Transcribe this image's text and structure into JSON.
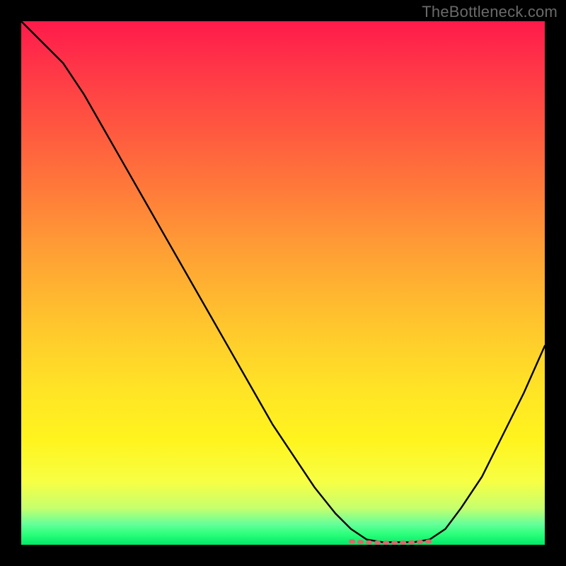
{
  "watermark": "TheBottleneck.com",
  "chart_data": {
    "type": "line",
    "title": "",
    "xlabel": "",
    "ylabel": "",
    "xlim": [
      0,
      100
    ],
    "ylim": [
      0,
      100
    ],
    "grid": false,
    "legend": false,
    "axes_visible": false,
    "background": "red-yellow-green vertical gradient",
    "series": [
      {
        "name": "bottleneck-curve",
        "color": "#000000",
        "x": [
          0,
          4,
          8,
          12,
          16,
          20,
          24,
          28,
          32,
          36,
          40,
          44,
          48,
          52,
          56,
          60,
          63,
          66,
          69,
          72,
          75,
          78,
          81,
          84,
          88,
          92,
          96,
          100
        ],
        "y": [
          100,
          96,
          92,
          86,
          79,
          72,
          65,
          58,
          51,
          44,
          37,
          30,
          23,
          17,
          11,
          6,
          3,
          1,
          0.5,
          0.5,
          0.5,
          1,
          3,
          7,
          13,
          21,
          29,
          38
        ]
      }
    ],
    "marker": {
      "name": "optimal-range",
      "color": "#d86a6a",
      "x_range": [
        63,
        78
      ],
      "y": 0.5,
      "note": "dashed/dotted segment on valley floor"
    }
  }
}
